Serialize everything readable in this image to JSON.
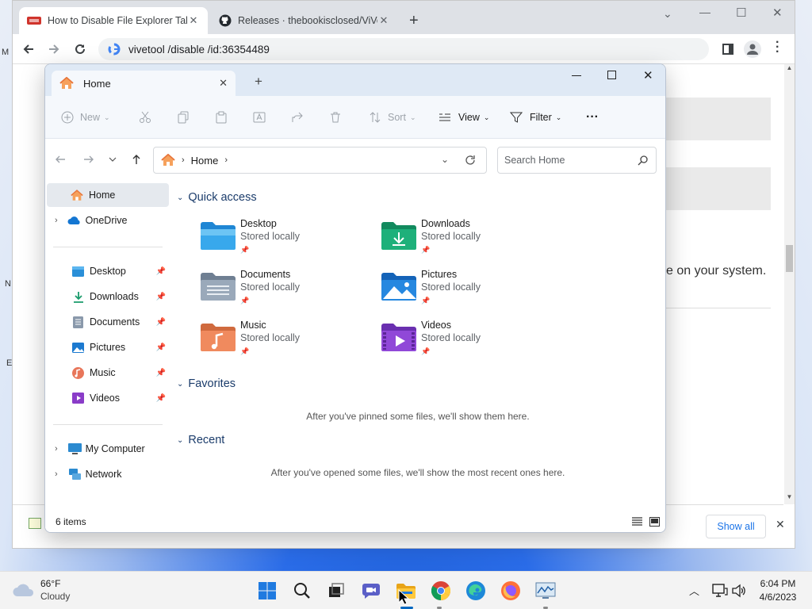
{
  "browser": {
    "tabs": [
      {
        "label": "How to Disable File Explorer Tab",
        "favicon": "site-favicon"
      },
      {
        "label": "Releases · thebookisclosed/ViVe",
        "favicon": "github-icon"
      }
    ],
    "new_tab": "+",
    "address": "vivetool /disable /id:36354489",
    "window_controls": {
      "minimize": "—",
      "maximize": "☐",
      "close": "✕"
    }
  },
  "webpage": {
    "visible_text": "e on your system.",
    "side_letters": [
      "M",
      "N",
      "E"
    ],
    "show_all": "Show all"
  },
  "explorer": {
    "tab": {
      "label": "Home"
    },
    "new_tab": "+",
    "commands": {
      "new": "New",
      "sort": "Sort",
      "view": "View",
      "filter": "Filter",
      "more": "···"
    },
    "address": {
      "location": "Home"
    },
    "search": {
      "placeholder": "Search Home"
    },
    "nav": {
      "home": "Home",
      "onedrive": "OneDrive",
      "pinned": [
        "Desktop",
        "Downloads",
        "Documents",
        "Pictures",
        "Music",
        "Videos"
      ],
      "my_computer": "My Computer",
      "network": "Network"
    },
    "sections": {
      "quick_access": "Quick access",
      "favorites": "Favorites",
      "recent": "Recent"
    },
    "quick_access": [
      {
        "name": "Desktop",
        "status": "Stored locally"
      },
      {
        "name": "Downloads",
        "status": "Stored locally"
      },
      {
        "name": "Documents",
        "status": "Stored locally"
      },
      {
        "name": "Pictures",
        "status": "Stored locally"
      },
      {
        "name": "Music",
        "status": "Stored locally"
      },
      {
        "name": "Videos",
        "status": "Stored locally"
      }
    ],
    "favorites_empty": "After you've pinned some files, we'll show them here.",
    "recent_empty": "After you've opened some files, we'll show the most recent ones here.",
    "status": "6 items"
  },
  "taskbar": {
    "weather": {
      "temp": "66°F",
      "condition": "Cloudy"
    },
    "clock": {
      "time": "6:04 PM",
      "date": "4/6/2023"
    }
  },
  "colors": {
    "accent": "#0067c0",
    "chrome_tab_bar": "#dee1e6",
    "explorer_titlebar": "#dfe9f5",
    "folder_blue": "#3aa0e8"
  }
}
